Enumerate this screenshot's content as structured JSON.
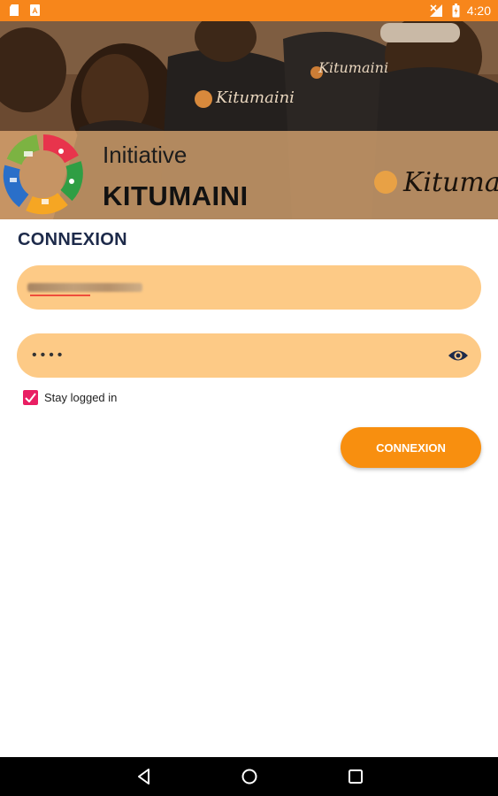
{
  "status_bar": {
    "time": "4:20",
    "left_icons": [
      "sd-card-icon",
      "app-notification-icon"
    ],
    "right_icons": [
      "no-signal-icon",
      "battery-icon"
    ],
    "color": "#f7861b"
  },
  "hero": {
    "title_line1": "Initiative",
    "title_line2": "KITUMAINI",
    "shirt_text": "Kitumaini",
    "logo": "kitumaini-logo"
  },
  "login": {
    "heading": "CONNEXION",
    "username_value": "",
    "password_mask": "••••",
    "stay_logged_in_label": "Stay logged in",
    "stay_logged_in_checked": true,
    "submit_label": "CONNEXION"
  },
  "nav_bar": {
    "buttons": [
      "back-icon",
      "home-icon",
      "recents-icon"
    ]
  },
  "colors": {
    "accent": "#f88f0f",
    "field_bg": "#fdca86",
    "checkbox": "#e91e63",
    "heading": "#1d2a4a"
  }
}
